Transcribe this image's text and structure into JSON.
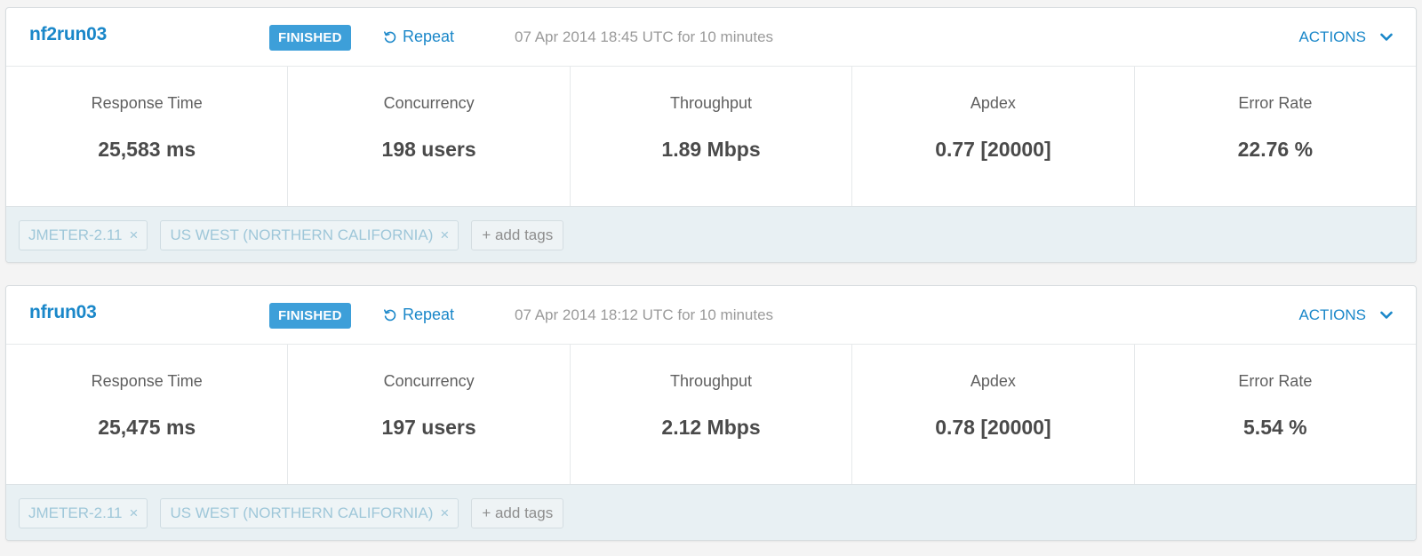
{
  "runs": [
    {
      "name": "nf2run03",
      "status": "FINISHED",
      "repeat_label": "Repeat",
      "time": "07 Apr 2014 18:45 UTC for 10 minutes",
      "actions_label": "ACTIONS",
      "metrics": [
        {
          "label": "Response Time",
          "value": "25,583 ms"
        },
        {
          "label": "Concurrency",
          "value": "198 users"
        },
        {
          "label": "Throughput",
          "value": "1.89 Mbps"
        },
        {
          "label": "Apdex",
          "value": "0.77 [20000]"
        },
        {
          "label": "Error Rate",
          "value": "22.76 %"
        }
      ],
      "tags": [
        "JMETER-2.11",
        "US WEST (NORTHERN CALIFORNIA)"
      ],
      "add_tags_label": "+ add tags"
    },
    {
      "name": "nfrun03",
      "status": "FINISHED",
      "repeat_label": "Repeat",
      "time": "07 Apr 2014 18:12 UTC for 10 minutes",
      "actions_label": "ACTIONS",
      "metrics": [
        {
          "label": "Response Time",
          "value": "25,475 ms"
        },
        {
          "label": "Concurrency",
          "value": "197 users"
        },
        {
          "label": "Throughput",
          "value": "2.12 Mbps"
        },
        {
          "label": "Apdex",
          "value": "0.78 [20000]"
        },
        {
          "label": "Error Rate",
          "value": "5.54 %"
        }
      ],
      "tags": [
        "JMETER-2.11",
        "US WEST (NORTHERN CALIFORNIA)"
      ],
      "add_tags_label": "+ add tags"
    }
  ],
  "icons": {
    "repeat": "repeat-icon",
    "actions_toggle": "chevron-down-icon",
    "tag_remove": "close-icon"
  },
  "colors": {
    "accent": "#1a87c9",
    "badge": "#3d9fd9",
    "tags_bar": "#e8f0f3"
  },
  "tag_remove_glyph": "×"
}
